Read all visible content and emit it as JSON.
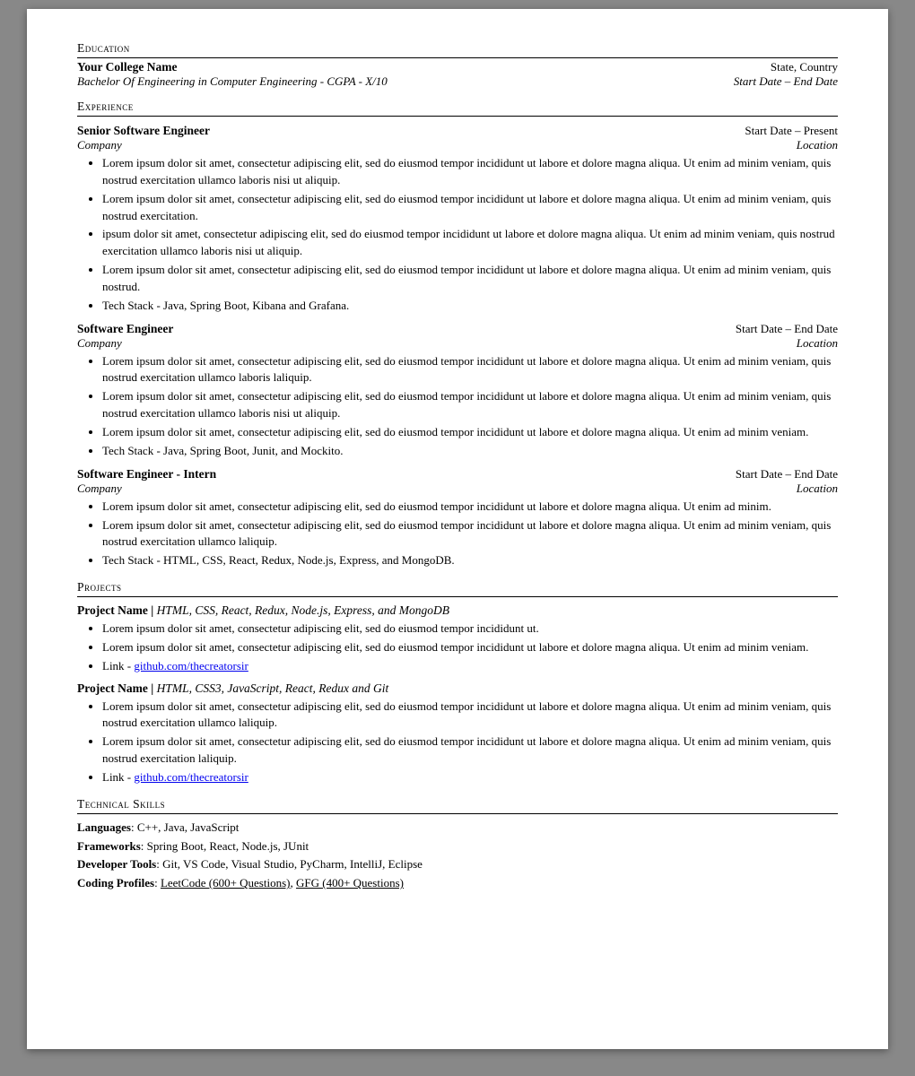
{
  "education": {
    "heading": "Education",
    "college": "Your College Name",
    "degree": "Bachelor Of Engineering in Computer Engineering - CGPA - X/10",
    "location": "State, Country",
    "dates": "Start Date – End Date"
  },
  "experience": {
    "heading": "Experience",
    "jobs": [
      {
        "title": "Senior Software Engineer",
        "dates": "Start Date – Present",
        "company": "Company",
        "location": "Location",
        "bullets": [
          "Lorem ipsum dolor sit amet, consectetur adipiscing elit, sed do eiusmod tempor incididunt ut labore et dolore magna aliqua. Ut enim ad minim veniam, quis nostrud exercitation ullamco laboris nisi ut aliquip.",
          "Lorem ipsum dolor sit amet, consectetur adipiscing elit, sed do eiusmod tempor incididunt ut labore et dolore magna aliqua. Ut enim ad minim veniam, quis nostrud exercitation.",
          "ipsum dolor sit amet, consectetur adipiscing elit, sed do eiusmod tempor incididunt ut labore et dolore magna aliqua. Ut enim ad minim veniam, quis nostrud exercitation ullamco laboris nisi ut aliquip.",
          "Lorem ipsum dolor sit amet, consectetur adipiscing elit, sed do eiusmod tempor incididunt ut labore et dolore magna aliqua. Ut enim ad minim veniam, quis nostrud.",
          "Tech Stack - Java, Spring Boot, Kibana and Grafana."
        ]
      },
      {
        "title": "Software Engineer",
        "dates": "Start Date – End Date",
        "company": "Company",
        "location": "Location",
        "bullets": [
          "Lorem ipsum dolor sit amet, consectetur adipiscing elit, sed do eiusmod tempor incididunt ut labore et dolore magna aliqua. Ut enim ad minim veniam, quis nostrud exercitation ullamco laboris laliquip.",
          "Lorem ipsum dolor sit amet, consectetur adipiscing elit, sed do eiusmod tempor incididunt ut labore et dolore magna aliqua. Ut enim ad minim veniam, quis nostrud exercitation ullamco laboris nisi ut aliquip.",
          "Lorem ipsum dolor sit amet, consectetur adipiscing elit, sed do eiusmod tempor incididunt ut labore et dolore magna aliqua. Ut enim ad minim veniam.",
          "Tech Stack - Java, Spring Boot, Junit, and Mockito."
        ]
      },
      {
        "title": "Software Engineer - Intern",
        "dates": "Start Date – End Date",
        "company": "Company",
        "location": "Location",
        "bullets": [
          "Lorem ipsum dolor sit amet, consectetur adipiscing elit, sed do eiusmod tempor incididunt ut labore et dolore magna aliqua. Ut enim ad minim.",
          "Lorem ipsum dolor sit amet, consectetur adipiscing elit, sed do eiusmod tempor incididunt ut labore et dolore magna aliqua. Ut enim ad minim veniam, quis nostrud exercitation ullamco laliquip.",
          "Tech Stack - HTML, CSS, React, Redux, Node.js, Express, and MongoDB."
        ]
      }
    ]
  },
  "projects": {
    "heading": "Projects",
    "items": [
      {
        "name": "Project Name",
        "tech": "HTML, CSS, React, Redux, Node.js, Express, and MongoDB",
        "bullets": [
          "Lorem ipsum dolor sit amet, consectetur adipiscing elit, sed do eiusmod tempor incididunt ut.",
          "Lorem ipsum dolor sit amet, consectetur adipiscing elit, sed do eiusmod tempor incididunt ut labore et dolore magna aliqua. Ut enim ad minim veniam.",
          "Link - github.com/thecreatorsir"
        ]
      },
      {
        "name": "Project Name",
        "tech": "HTML, CSS3, JavaScript, React, Redux and Git",
        "bullets": [
          "Lorem ipsum dolor sit amet, consectetur adipiscing elit, sed do eiusmod tempor incididunt ut labore et dolore magna aliqua. Ut enim ad minim veniam, quis nostrud exercitation ullamco laliquip.",
          "Lorem ipsum dolor sit amet, consectetur adipiscing elit, sed do eiusmod tempor incididunt ut labore et dolore magna aliqua. Ut enim ad minim veniam, quis nostrud exercitation laliquip.",
          "Link - github.com/thecreatorsir"
        ]
      }
    ]
  },
  "technical_skills": {
    "heading": "Technical Skills",
    "items": [
      {
        "label": "Languages",
        "value": "C++, Java, JavaScript"
      },
      {
        "label": "Frameworks",
        "value": "Spring Boot, React, Node.js, JUnit"
      },
      {
        "label": "Developer Tools",
        "value": "Git, VS Code, Visual Studio, PyCharm, IntelliJ, Eclipse"
      },
      {
        "label": "Coding Profiles",
        "value": "LeetCode (600+ Questions), GFG (400+ Questions)",
        "links": true
      }
    ]
  }
}
